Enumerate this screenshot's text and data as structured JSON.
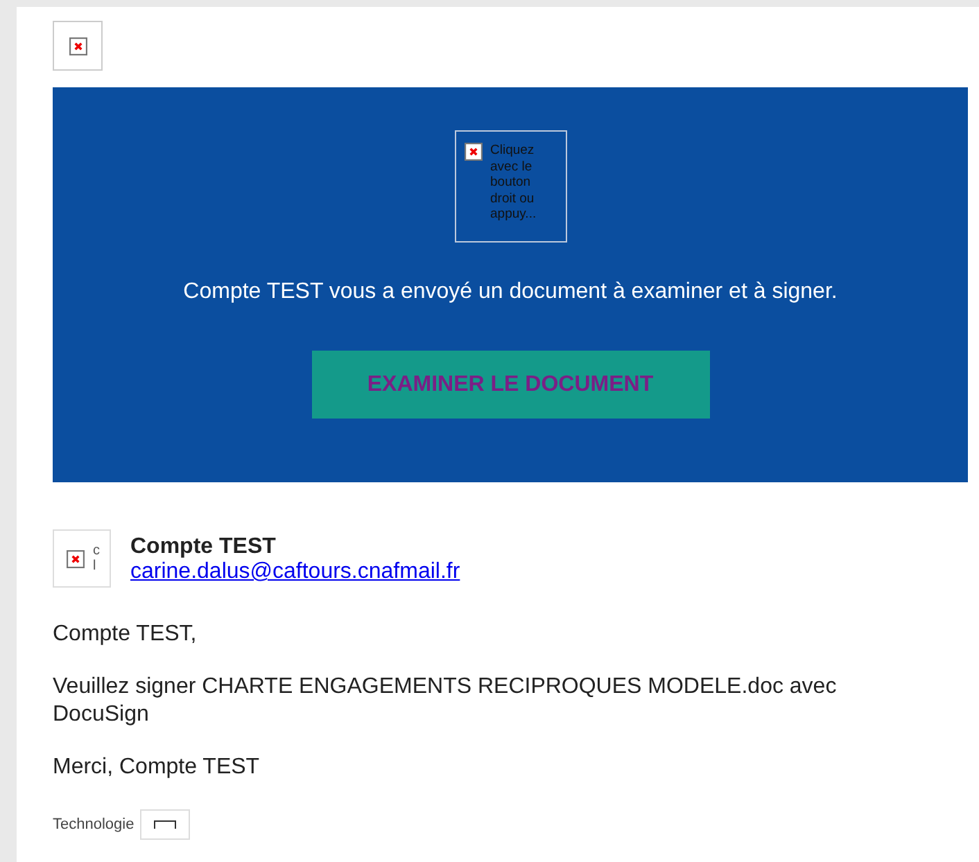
{
  "banner": {
    "image_alt": "Cliquez avec le bouton droit ou appuy...",
    "message": "Compte TEST vous a envoyé un document à examiner et à signer.",
    "button": "EXAMINER LE DOCUMENT"
  },
  "sender": {
    "avatar_alt": [
      "c",
      "l"
    ],
    "name": "Compte TEST",
    "email": "carine.dalus@caftours.cnafmail.fr"
  },
  "body": [
    "Compte TEST,",
    "Veuillez signer CHARTE ENGAGEMENTS RECIPROQUES MODELE.doc avec DocuSign",
    "Merci, Compte TEST"
  ],
  "footer": {
    "label": "Technologie"
  }
}
